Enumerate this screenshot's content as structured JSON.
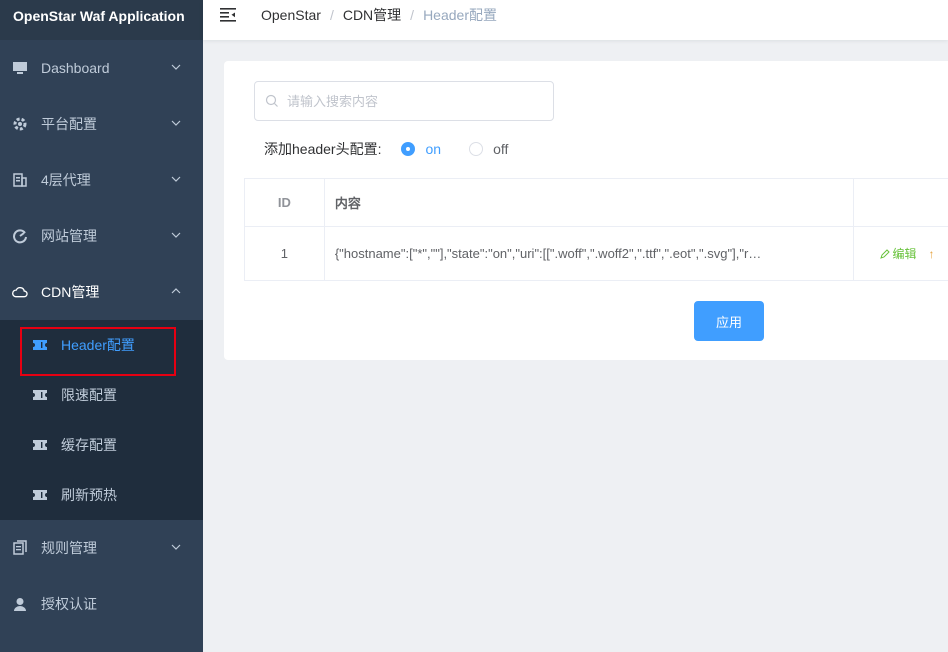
{
  "app": {
    "title": "OpenStar Waf Application"
  },
  "sidebar": {
    "items": [
      {
        "label": "Dashboard",
        "icon": "monitor-icon"
      },
      {
        "label": "平台配置",
        "icon": "gear-icon"
      },
      {
        "label": "4层代理",
        "icon": "building-icon"
      },
      {
        "label": "网站管理",
        "icon": "gauge-icon"
      },
      {
        "label": "CDN管理",
        "icon": "cloud-icon"
      },
      {
        "label": "规则管理",
        "icon": "document-icon"
      },
      {
        "label": "授权认证",
        "icon": "user-icon"
      }
    ],
    "cdn_sub": [
      {
        "label": "Header配置",
        "icon": "ticket-icon"
      },
      {
        "label": "限速配置",
        "icon": "ticket-icon"
      },
      {
        "label": "缓存配置",
        "icon": "ticket-icon"
      },
      {
        "label": "刷新预热",
        "icon": "ticket-icon"
      }
    ]
  },
  "breadcrumb": [
    "OpenStar",
    "CDN管理",
    "Header配置"
  ],
  "search": {
    "placeholder": "请输入搜索内容",
    "value": ""
  },
  "header_toggle": {
    "label": "添加header头配置:",
    "options": [
      "on",
      "off"
    ],
    "selected": "on"
  },
  "table": {
    "headers": [
      "ID",
      "内容",
      ""
    ],
    "rows": [
      {
        "id": "1",
        "content": "{\"hostname\":[\"*\",\"\"],\"state\":\"on\",\"uri\":[[\".woff\",\".woff2\",\".ttf\",\".eot\",\".svg\"],\"r…",
        "edit_label": "编辑",
        "up_label": "↑"
      }
    ]
  },
  "apply_label": "应用",
  "colors": {
    "sidebar_bg": "#304156",
    "submenu_bg": "#1f2d3d",
    "accent": "#409eff",
    "highlight": "#e60012"
  }
}
